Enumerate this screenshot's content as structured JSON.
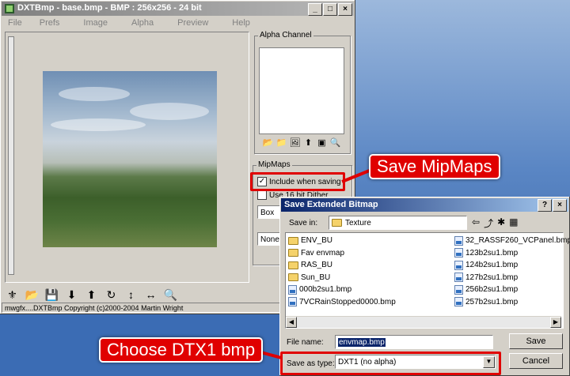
{
  "window": {
    "title": "DXTBmp - base.bmp - BMP : 256x256 - 24 bit",
    "min": "_",
    "max": "□",
    "close": "×"
  },
  "menu": [
    "File",
    "Prefs",
    "Image",
    "Alpha",
    "Preview",
    "Help"
  ],
  "alpha_panel": {
    "label": "Alpha Channel"
  },
  "mipmaps": {
    "label": "MipMaps",
    "include_label": "Include when saving",
    "include_checked": "✓",
    "dither_label": "Use 16 bit Dither",
    "filter_value": "Box",
    "second_value": "None"
  },
  "status": "mwgfx....DXTBmp Copyright (c)2000-2004 Martin Wright",
  "dialog": {
    "title": "Save Extended Bitmap",
    "help": "?",
    "close": "×",
    "save_in_label": "Save in:",
    "save_in_value": "Texture",
    "folders": [
      "ENV_BU",
      "Fav envmap",
      "RAS_BU",
      "Sun_BU"
    ],
    "files_col1": [
      "000b2su1.bmp",
      "7VCRainStopped0000.bmp"
    ],
    "files_col2": [
      "32_RASSF260_VCPanel.bmp",
      "123b2su1.bmp",
      "124b2su1.bmp",
      "127b2su1.bmp",
      "256b2su1.bmp",
      "257b2su1.bmp"
    ],
    "file_name_label": "File name:",
    "file_name_value": "envmap.bmp",
    "save_type_label": "Save as type:",
    "save_type_value": "DXT1 (no alpha)",
    "save_button": "Save",
    "cancel_button": "Cancel"
  },
  "callouts": {
    "save_mipmaps": "Save MipMaps",
    "choose_dxt1": "Choose DTX1 bmp"
  },
  "colors": {
    "highlight": "#e00000",
    "dialog_title": "#0a246a"
  }
}
